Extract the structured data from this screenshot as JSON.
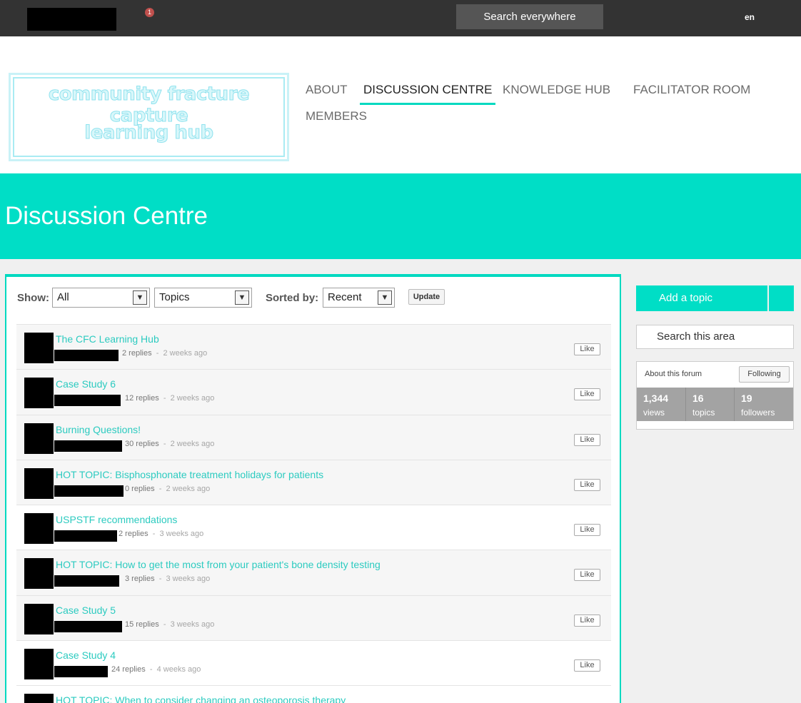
{
  "topbar": {
    "notification_count": "1",
    "search_label": "Search everywhere",
    "language": "en"
  },
  "brand": {
    "line1": "community fracture capture",
    "line2": "learning hub"
  },
  "nav": {
    "about": "ABOUT",
    "discussion": "DISCUSSION CENTRE",
    "knowledge": "KNOWLEDGE HUB",
    "facilitator": "FACILITATOR ROOM",
    "members": "MEMBERS"
  },
  "banner": {
    "title": "Discussion Centre"
  },
  "filters": {
    "show_label": "Show:",
    "show_value": "All",
    "type_value": "Topics",
    "sort_label": "Sorted by:",
    "sort_value": "Recent",
    "update_label": "Update"
  },
  "topics": [
    {
      "title": "The CFC Learning Hub",
      "replies": "2 replies",
      "age": "2 weeks ago",
      "like": "Like"
    },
    {
      "title": "Case Study 6",
      "replies": "12 replies",
      "age": "2 weeks ago",
      "like": "Like"
    },
    {
      "title": "Burning Questions!",
      "replies": "30 replies",
      "age": "2 weeks ago",
      "like": "Like"
    },
    {
      "title": "HOT TOPIC: Bisphosphonate treatment holidays for patients",
      "replies": "0 replies",
      "age": "2 weeks ago",
      "like": "Like"
    },
    {
      "title": "USPSTF recommendations",
      "replies": "2 replies",
      "age": "3 weeks ago",
      "like": "Like"
    },
    {
      "title": "HOT TOPIC: How to get the most from your patient's bone density testing",
      "replies": "3 replies",
      "age": "3 weeks ago",
      "like": "Like"
    },
    {
      "title": "Case Study 5",
      "replies": "15 replies",
      "age": "3 weeks ago",
      "like": "Like"
    },
    {
      "title": "Case Study 4",
      "replies": "24 replies",
      "age": "4 weeks ago",
      "like": "Like"
    },
    {
      "title": "HOT TOPIC: When to consider changing an osteoporosis therapy",
      "replies": "",
      "age": "",
      "like": ""
    }
  ],
  "sidebar": {
    "add_topic": "Add a topic",
    "search_area": "Search this area",
    "about_forum": "About this forum",
    "following": "Following",
    "stats": [
      {
        "num": "1,344",
        "label": "views"
      },
      {
        "num": "16",
        "label": "topics"
      },
      {
        "num": "19",
        "label": "followers"
      }
    ]
  },
  "colors": {
    "accent": "#00dec6",
    "link": "#2ccbc0",
    "topbar": "#333333"
  }
}
